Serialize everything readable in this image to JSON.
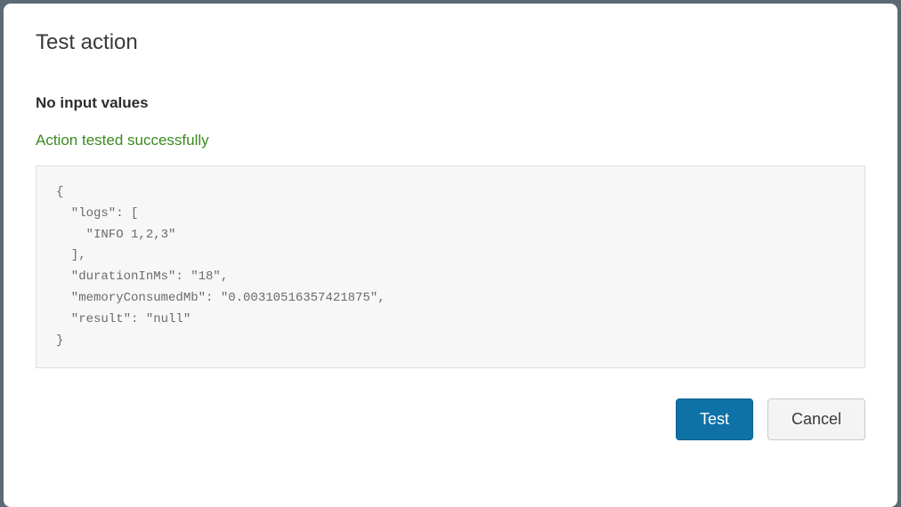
{
  "dialog": {
    "title": "Test action",
    "no_input_label": "No input values",
    "success_message": "Action tested successfully",
    "output_json": "{\n  \"logs\": [\n    \"INFO 1,2,3\"\n  ],\n  \"durationInMs\": \"18\",\n  \"memoryConsumedMb\": \"0.00310516357421875\",\n  \"result\": \"null\"\n}",
    "buttons": {
      "test_label": "Test",
      "cancel_label": "Cancel"
    }
  }
}
